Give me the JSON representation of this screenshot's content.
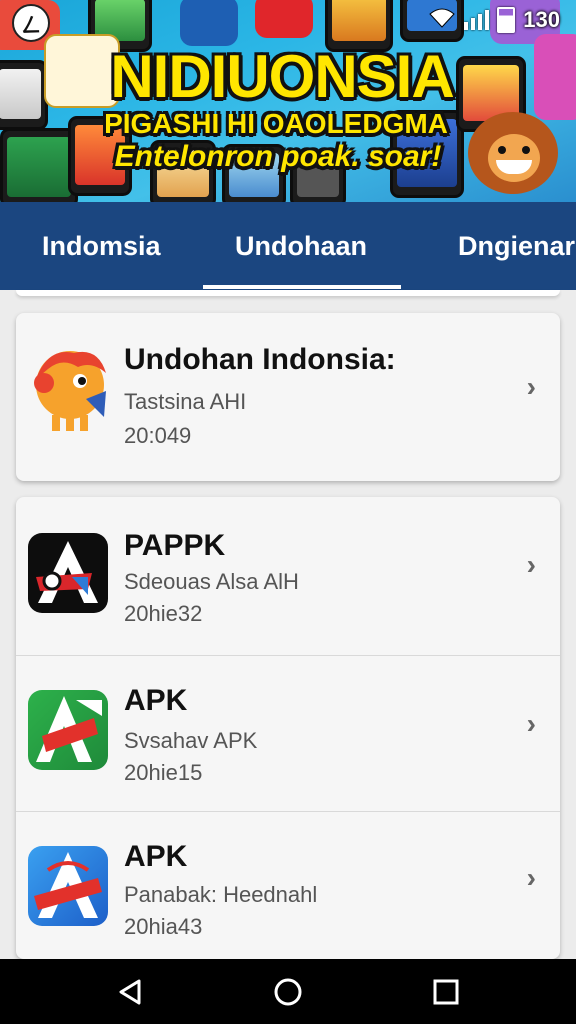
{
  "status_bar": {
    "left_glyph": "ㄥ",
    "time": "130"
  },
  "banner": {
    "title": "NIDIUONSIA",
    "subtitle": "PIGASHI HI OAOLEDGMA",
    "tagline": "Entelonron poak. soar!"
  },
  "tabs": [
    {
      "label": "Indomsia",
      "selected": false
    },
    {
      "label": "Undohaan",
      "selected": true
    },
    {
      "label": "Dngienar",
      "selected": false
    }
  ],
  "featured": {
    "title": "Undohan Indonsia:",
    "subtitle": "Tastsina AHI",
    "date": "20:049",
    "icon": "mascot-icon"
  },
  "apps": [
    {
      "title": "PAPPK",
      "subtitle": "Sdeouas Alsa AlH",
      "date": "20hie32",
      "icon": "app-logo-black-icon"
    },
    {
      "title": "APK",
      "subtitle": "Svsahav APK",
      "date": "20hie15",
      "icon": "app-logo-green-icon"
    },
    {
      "title": "APK",
      "subtitle": "Panabak: Heednahl",
      "date": "20hia43",
      "icon": "app-logo-blue-icon"
    }
  ],
  "navigation": {
    "back": "back-icon",
    "home": "home-icon",
    "recents": "recents-icon"
  },
  "colors": {
    "tab_bar": "#1b4680",
    "banner_title": "#ffe600",
    "background": "#ececec"
  }
}
